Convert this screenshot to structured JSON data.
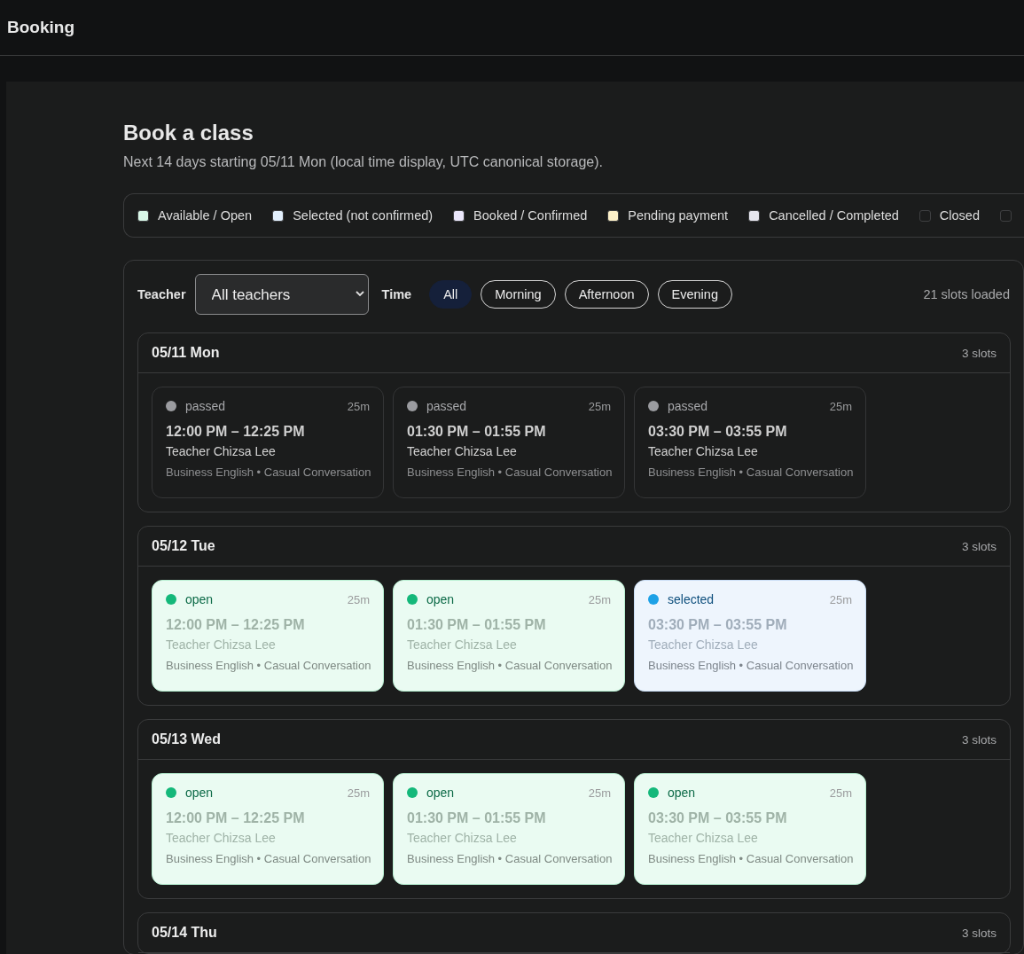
{
  "app_bar": {
    "title": "Booking"
  },
  "page": {
    "title": "Book a class",
    "subtitle": "Next 14 days starting 05/11 Mon (local time display, UTC canonical storage)."
  },
  "legend": [
    {
      "label": "Available / Open",
      "color": "#d9f7e8"
    },
    {
      "label": "Selected (not confirmed)",
      "color": "#e3f0fd"
    },
    {
      "label": "Booked / Confirmed",
      "color": "#ebe7fb"
    },
    {
      "label": "Pending payment",
      "color": "#fdf1c9"
    },
    {
      "label": "Cancelled / Completed",
      "color": "#e6e6ee"
    },
    {
      "label": "Closed",
      "color": "#1b1c1c"
    },
    {
      "color": "#1b1c1c"
    }
  ],
  "filters": {
    "teacher_label": "Teacher",
    "teacher_select": {
      "value": "All teachers"
    },
    "time_label": "Time",
    "time_chips": [
      {
        "label": "All",
        "selected": true
      },
      {
        "label": "Morning",
        "selected": false
      },
      {
        "label": "Afternoon",
        "selected": false
      },
      {
        "label": "Evening",
        "selected": false
      }
    ],
    "count": "21 slots loaded"
  },
  "days": [
    {
      "date": "05/11 Mon",
      "count": "3 slots",
      "slots": [
        {
          "kind": "passed",
          "status": "passed",
          "duration": "25m",
          "time": "12:00 PM – 12:25 PM",
          "teacher": "Teacher Chizsa Lee",
          "topics": "Business English • Casual Conversation"
        },
        {
          "kind": "passed",
          "status": "passed",
          "duration": "25m",
          "time": "01:30 PM – 01:55 PM",
          "teacher": "Teacher Chizsa Lee",
          "topics": "Business English • Casual Conversation"
        },
        {
          "kind": "passed",
          "status": "passed",
          "duration": "25m",
          "time": "03:30 PM – 03:55 PM",
          "teacher": "Teacher Chizsa Lee",
          "topics": "Business English • Casual Conversation"
        }
      ]
    },
    {
      "date": "05/12 Tue",
      "count": "3 slots",
      "slots": [
        {
          "kind": "open",
          "status": "open",
          "duration": "25m",
          "time": "12:00 PM – 12:25 PM",
          "teacher": "Teacher Chizsa Lee",
          "topics": "Business English • Casual Conversation"
        },
        {
          "kind": "open",
          "status": "open",
          "duration": "25m",
          "time": "01:30 PM – 01:55 PM",
          "teacher": "Teacher Chizsa Lee",
          "topics": "Business English • Casual Conversation"
        },
        {
          "kind": "selected",
          "status": "selected",
          "duration": "25m",
          "time": "03:30 PM – 03:55 PM",
          "teacher": "Teacher Chizsa Lee",
          "topics": "Business English • Casual Conversation"
        }
      ]
    },
    {
      "date": "05/13 Wed",
      "count": "3 slots",
      "slots": [
        {
          "kind": "open",
          "status": "open",
          "duration": "25m",
          "time": "12:00 PM – 12:25 PM",
          "teacher": "Teacher Chizsa Lee",
          "topics": "Business English • Casual Conversation"
        },
        {
          "kind": "open",
          "status": "open",
          "duration": "25m",
          "time": "01:30 PM – 01:55 PM",
          "teacher": "Teacher Chizsa Lee",
          "topics": "Business English • Casual Conversation"
        },
        {
          "kind": "open",
          "status": "open",
          "duration": "25m",
          "time": "03:30 PM – 03:55 PM",
          "teacher": "Teacher Chizsa Lee",
          "topics": "Business English • Casual Conversation"
        }
      ]
    },
    {
      "date": "05/14 Thu",
      "count": "3 slots"
    }
  ]
}
